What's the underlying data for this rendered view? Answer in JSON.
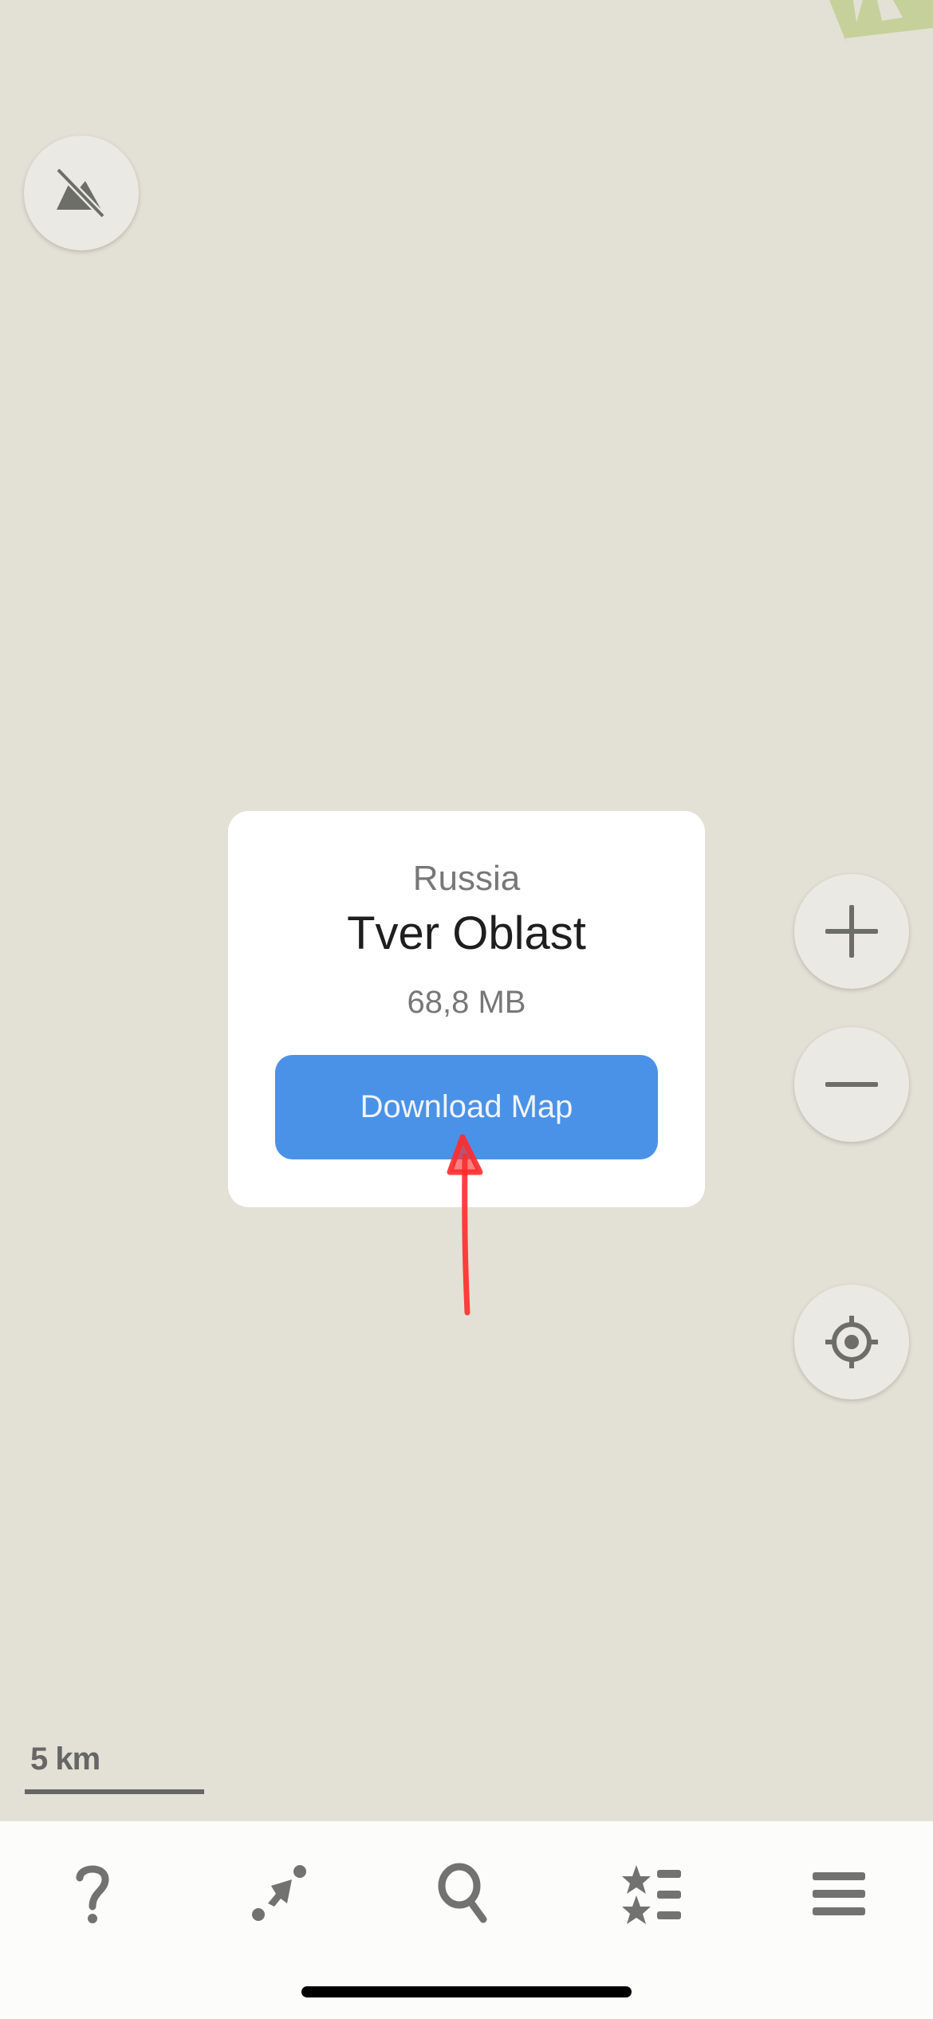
{
  "map": {
    "scale_label": "5 km",
    "buttons": {
      "terrain": "terrain-off-icon",
      "zoom_in": "plus-icon",
      "zoom_out": "minus-icon",
      "my_location": "location-target-icon"
    }
  },
  "download_card": {
    "country": "Russia",
    "region": "Tver Oblast",
    "size": "68,8 MB",
    "button_label": "Download Map",
    "button_color": "#4a92e7"
  },
  "annotation": {
    "arrow_color": "#ff2b2b"
  },
  "tabbar": {
    "items": [
      {
        "icon": "help-icon"
      },
      {
        "icon": "route-icon"
      },
      {
        "icon": "search-icon"
      },
      {
        "icon": "bookmarks-icon"
      },
      {
        "icon": "menu-icon"
      }
    ]
  }
}
